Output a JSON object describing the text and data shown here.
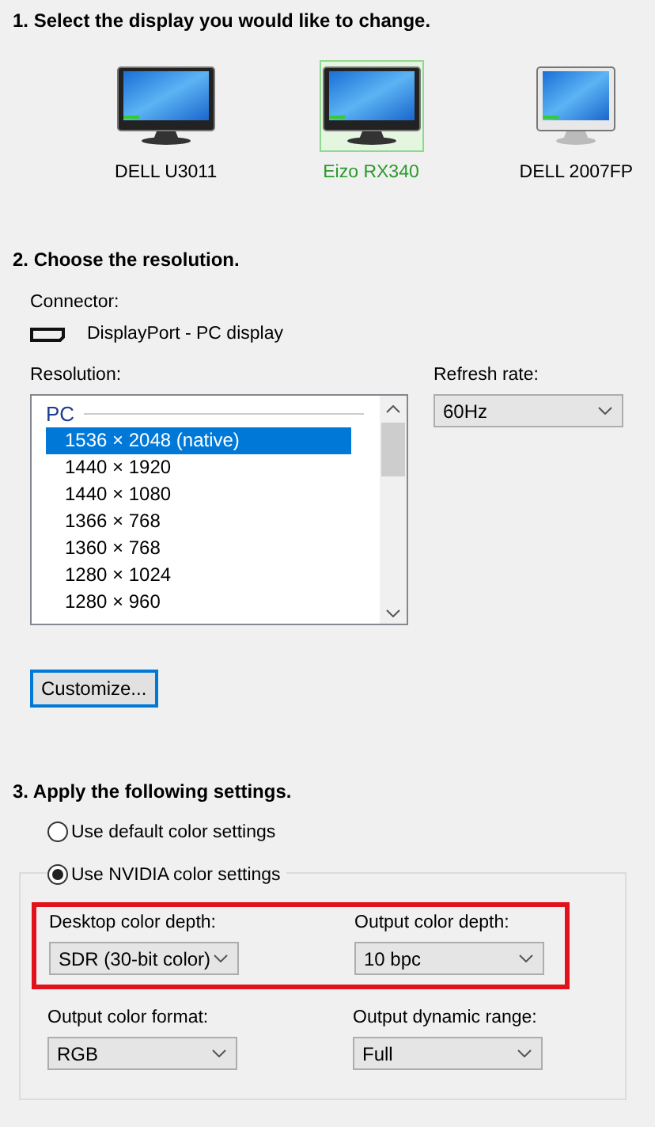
{
  "display_section": {
    "heading": "1. Select the display you would like to change.",
    "displays": [
      {
        "name": "DELL U3011",
        "selected": false,
        "kind": "black"
      },
      {
        "name": "Eizo RX340",
        "selected": true,
        "kind": "black"
      },
      {
        "name": "DELL 2007FP",
        "selected": false,
        "kind": "silver"
      }
    ]
  },
  "resolution_section": {
    "heading": "2. Choose the resolution.",
    "connector_label": "Connector:",
    "connector": "DisplayPort - PC display",
    "resolution_label": "Resolution:",
    "refresh_label": "Refresh rate:",
    "refresh_rate": "60Hz",
    "customize_button": "Customize...",
    "resolution_list": {
      "group": "PC",
      "items": [
        {
          "label": "1536 × 2048 (native)",
          "selected": true
        },
        {
          "label": "1440 × 1920",
          "selected": false
        },
        {
          "label": "1440 × 1080",
          "selected": false
        },
        {
          "label": "1366 × 768",
          "selected": false
        },
        {
          "label": "1360 × 768",
          "selected": false
        },
        {
          "label": "1280 × 1024",
          "selected": false
        },
        {
          "label": "1280 × 960",
          "selected": false
        }
      ]
    }
  },
  "color_section": {
    "heading": "3. Apply the following settings.",
    "options": [
      {
        "label": "Use default color settings",
        "selected": false
      },
      {
        "label": "Use NVIDIA color settings",
        "selected": true
      }
    ],
    "rows": [
      {
        "highlighted": true,
        "fields": [
          {
            "label": "Desktop color depth:",
            "value": "SDR (30-bit color)"
          },
          {
            "label": "Output color depth:",
            "value": "10 bpc"
          }
        ]
      },
      {
        "highlighted": false,
        "fields": [
          {
            "label": "Output color format:",
            "value": "RGB"
          },
          {
            "label": "Output dynamic range:",
            "value": "Full"
          }
        ]
      }
    ]
  }
}
